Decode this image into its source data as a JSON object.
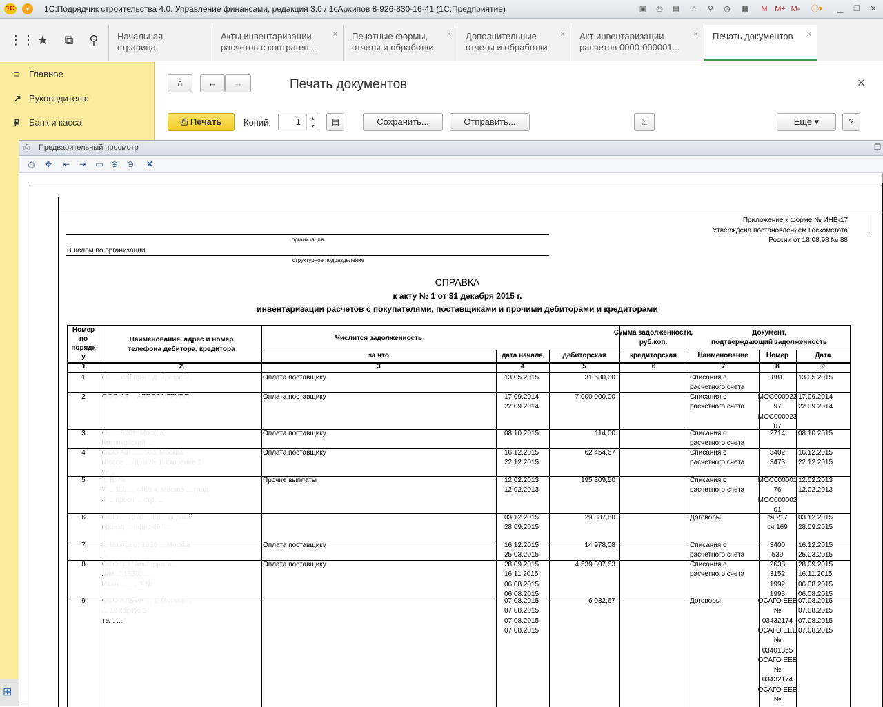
{
  "window": {
    "title": "1С:Подрядчик строительства 4.0. Управление финансами, редакция 3.0 / 1сАрхипов 8-926-830-16-41  (1С:Предприятие)",
    "logo": "1С",
    "mem": [
      "M",
      "M+",
      "M-"
    ]
  },
  "tabs": [
    {
      "l1": "Начальная страница",
      "l2": "",
      "closable": false
    },
    {
      "l1": "Акты инвентаризации",
      "l2": "расчетов с контраген...",
      "closable": true
    },
    {
      "l1": "Печатные формы,",
      "l2": "отчеты и обработки",
      "closable": true
    },
    {
      "l1": "Дополнительные",
      "l2": "отчеты и обработки",
      "closable": true
    },
    {
      "l1": "Акт инвентаризации",
      "l2": "расчетов 0000-000001...",
      "closable": true
    },
    {
      "l1": "Печать документов",
      "l2": "",
      "closable": true
    }
  ],
  "sidebar": [
    {
      "label": "Главное",
      "icon": "menu-icon"
    },
    {
      "label": "Руководителю",
      "icon": "chart-icon"
    },
    {
      "label": "Банк и касса",
      "icon": "ruble-icon"
    }
  ],
  "toolbar": {
    "title": "Печать документов",
    "print": "Печать",
    "copies_label": "Копий:",
    "copies": "1",
    "save": "Сохранить...",
    "send": "Отправить...",
    "more": "Еще",
    "help": "?",
    "close": "×"
  },
  "preview": {
    "title": "Предварительный просмотр"
  },
  "doc": {
    "app1": "Приложение к форме № ИНВ-17",
    "app2": "Утверждена постановлением Госкомстата",
    "app3": "России от 18.08.98 № 88",
    "org_caption": "организация",
    "dept_value": "В целом по организации",
    "dept_caption": "структурное подразделение",
    "title": "СПРАВКА",
    "sub1": "к акту № 1 от 31 декабря 2015 г.",
    "sub2": "инвентаризации расчетов с покупателями, поставщиками и прочими дебиторами и кредиторами",
    "h_num": [
      "Номер",
      "по",
      "порядк",
      "у"
    ],
    "h_name": [
      "Наименование, адрес и номер",
      "телефона дебитора, кредитора"
    ],
    "h_debt": "Числится задолженность",
    "h_sum": [
      "Сумма задолженности,",
      "руб.коп."
    ],
    "h_doc": [
      "Документ,",
      "подтверждающий задолженность"
    ],
    "h_for": "за что",
    "h_date": "дата начала",
    "h_deb": "дебиторская",
    "h_cred": "кредиторская",
    "h_dname": "Наименование",
    "h_dnum": "Номер",
    "h_ddate": "Дата",
    "colnums": [
      "1",
      "2",
      "3",
      "4",
      "5",
      "6",
      "7",
      "8",
      "9"
    ],
    "rows": [
      {
        "n": "1",
        "name": [
          "О... ...кий пр-кт, д. 3, корп.2"
        ],
        "for": "Оплата поставщику",
        "dates": [
          "13.05.2015"
        ],
        "deb": "31 680,00",
        "dname": [
          "Списания с",
          "расчетного счета"
        ],
        "dnum": [
          "881"
        ],
        "ddate": [
          "13.05.2015"
        ]
      },
      {
        "n": "2",
        "name": [
          "ООО АБ... АВРОРА ГРУПП"
        ],
        "for": "Оплата поставщику",
        "dates": [
          "17.09.2014",
          "22.09.2014"
        ],
        "deb": "7 000 000,00",
        "dname": [
          "Списания с",
          "расчетного счета"
        ],
        "dnum": [
          "МОС000022",
          "97",
          "МОС000023",
          "07"
        ],
        "ddate": [
          "17.09.2014",
          "22.09.2014"
        ]
      },
      {
        "n": "3",
        "name": [
          "О... ...5201, Москва,",
          "Котляковский ..."
        ],
        "for": "Оплата поставщику",
        "dates": [
          "08.10.2015"
        ],
        "deb": "114,00",
        "dname": [
          "Списания с",
          "расчетного счета"
        ],
        "dnum": [
          "2714"
        ],
        "ddate": [
          "08.10.2015"
        ]
      },
      {
        "n": "4",
        "name": [
          "ООО Авт... ...583, Москва,",
          "Шоссе ..., дом № 1, строение 1,",
          "те..."
        ],
        "for": "Оплата поставщику",
        "dates": [
          "16.12.2015",
          "22.12.2015"
        ],
        "deb": "62 454,67",
        "dname": [
          "Списания с",
          "расчетного счета"
        ],
        "dnum": [
          "3402",
          "3473"
        ],
        "ddate": [
          "16.12.2015",
          "22.12.2015"
        ]
      },
      {
        "n": "5",
        "name": [
          "... Б. №",
          "7 ... 110 ... 4460, г. Москва ... град,",
          "4 ... просп ... стр. ..."
        ],
        "for": "Прочие выплаты",
        "dates": [
          "12.02.2013",
          "12.02.2013"
        ],
        "deb": "195 309,50",
        "dname": [
          "Списания с",
          "расчетного счета"
        ],
        "dnum": [
          "МОС000001",
          "76",
          "МОС000002",
          "01"
        ],
        "ddate": [
          "12.02.2013",
          "12.02.2013"
        ]
      },
      {
        "n": "6",
        "name": [
          "ООО ... 7076 ... Кр... родный",
          "проезд ... офис 408 ..."
        ],
        "for": "",
        "dates": [
          "03.12.2015",
          "28.09.2015"
        ],
        "deb": "29 887,80",
        "dname": [
          "Договоры"
        ],
        "dnum": [
          "сч.217",
          "сч.169"
        ],
        "ddate": [
          "03.12.2015",
          "28.09.2015"
        ]
      },
      {
        "n": "7",
        "name": [
          "... монтресс 1030 ... Москва",
          "..."
        ],
        "for": "Оплата поставщику",
        "dates": [
          "16.12.2015",
          "25.03.2015"
        ],
        "deb": "14 978,08",
        "dname": [
          "Списания с",
          "расчетного счета"
        ],
        "dnum": [
          "3400",
          "539"
        ],
        "ddate": [
          "16.12.2015",
          "25.03.2015"
        ]
      },
      {
        "n": "8",
        "name": [
          "ООО ЭП \"Альтернати...",
          "лии...\",15300 ...",
          "Иван... ... ...1 №"
        ],
        "for": "Оплата поставщику",
        "dates": [
          "28.09.2015",
          "16.11.2015",
          "06.08.2015",
          "06.08.2015"
        ],
        "deb": "4 539 807,63",
        "dname": [
          "Списания с",
          "расчетного счета"
        ],
        "dnum": [
          "2638",
          "3152",
          "1992",
          "1993"
        ],
        "ddate": [
          "28.09.2015",
          "16.11.2015",
          "06.08.2015",
          "06.08.2015"
        ]
      },
      {
        "n": "9",
        "name": [
          "ООО АЛЬФА ... 1, Москва ...",
          "... 10 корпус 5",
          "тел. ..."
        ],
        "for": "",
        "dates": [
          "07.08.2015",
          "07.08.2015",
          "07.08.2015",
          "07.08.2015"
        ],
        "deb": "6 032,67",
        "dname": [
          "Договоры"
        ],
        "dnum": [
          "ОСАГО ЕЕЕ",
          "№",
          "03432174",
          "ОСАГО ЕЕЕ",
          "№",
          "03401355",
          "ОСАГО ЕЕЕ",
          "№",
          "03432174",
          "ОСАГО ЕЕЕ",
          "№"
        ],
        "ddate": [
          "07.08.2015",
          "07.08.2015",
          "07.08.2015",
          "07.08.2015"
        ]
      }
    ]
  }
}
